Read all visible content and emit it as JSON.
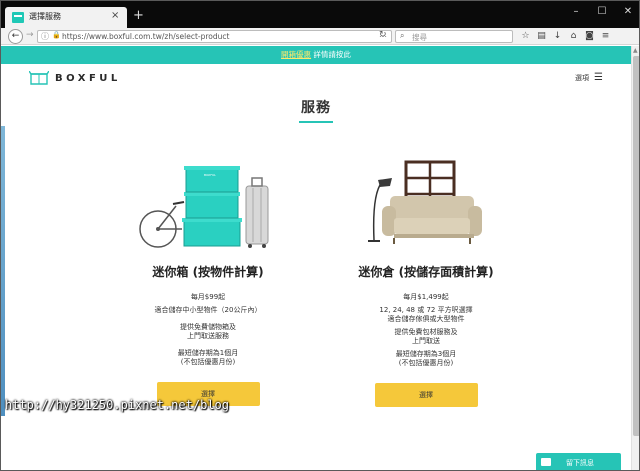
{
  "browser": {
    "tab_title": "選擇服務",
    "tab_close": "×",
    "new_tab": "+",
    "url": "https://www.boxful.com.tw/zh/select-product",
    "search_placeholder": "搜尋",
    "window_controls": [
      "–",
      "☐",
      "✕"
    ]
  },
  "promo": {
    "link_text": "開箱優惠",
    "text": " 詳情請按此"
  },
  "header": {
    "brand": "BOXFUL",
    "menu_label": "選項"
  },
  "page_title": "服務",
  "cards": [
    {
      "name": "迷你箱 (按物件計算)",
      "price": "每月$99起",
      "lines_a": [
        "適合儲存中小型物件（20公斤內）"
      ],
      "lines_b": [
        "提供免費儲物箱及",
        "上門取送服務"
      ],
      "lines_c": [
        "最短儲存期為1個月",
        "(不包括優惠月份)"
      ],
      "button": "選擇"
    },
    {
      "name": "迷你倉 (按儲存面積計算)",
      "price": "每月$1,499起",
      "lines_a": [
        "12, 24, 48 或 72 平方呎選擇",
        "適合儲存傢俱或大型物件"
      ],
      "lines_b": [
        "提供免費包材服務及",
        "上門取送"
      ],
      "lines_c": [
        "最短儲存期為3個月",
        "(不包括優惠月份)"
      ],
      "button": "選擇"
    }
  ],
  "watermark": "http://hy321250.pixnet.net/blog",
  "chat_label": "留下訊息",
  "colors": {
    "accent": "#26c4b6",
    "button": "#f5c83a"
  }
}
